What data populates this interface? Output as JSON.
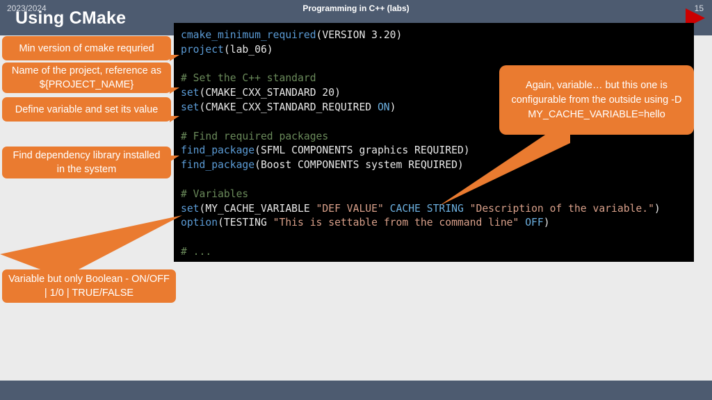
{
  "slide": {
    "title": "Using CMake",
    "play_icon": "play-triangle-icon",
    "accent_color": "#ea7b30",
    "header_color": "#4d5b70",
    "code_bg_color": "#000000"
  },
  "code": {
    "language": "cmake",
    "lines": [
      [
        {
          "t": "cmake_minimum_required",
          "c": "fn"
        },
        {
          "t": "(VERSION 3.20)",
          "c": "plain"
        }
      ],
      [
        {
          "t": "project",
          "c": "fn"
        },
        {
          "t": "(lab_06)",
          "c": "plain"
        }
      ],
      [],
      [
        {
          "t": "# Set the C++ standard",
          "c": "comment"
        }
      ],
      [
        {
          "t": "set",
          "c": "fn"
        },
        {
          "t": "(CMAKE_CXX_STANDARD 20)",
          "c": "plain"
        }
      ],
      [
        {
          "t": "set",
          "c": "fn"
        },
        {
          "t": "(CMAKE_CXX_STANDARD_REQUIRED ",
          "c": "plain"
        },
        {
          "t": "ON",
          "c": "kw"
        },
        {
          "t": ")",
          "c": "plain"
        }
      ],
      [],
      [
        {
          "t": "# Find required packages",
          "c": "comment"
        }
      ],
      [
        {
          "t": "find_package",
          "c": "fn"
        },
        {
          "t": "(SFML COMPONENTS graphics REQUIRED)",
          "c": "plain"
        }
      ],
      [
        {
          "t": "find_package",
          "c": "fn"
        },
        {
          "t": "(Boost COMPONENTS system REQUIRED)",
          "c": "plain"
        }
      ],
      [],
      [
        {
          "t": "# Variables",
          "c": "comment"
        }
      ],
      [
        {
          "t": "set",
          "c": "fn"
        },
        {
          "t": "(MY_CACHE_VARIABLE ",
          "c": "plain"
        },
        {
          "t": "\"DEF VALUE\"",
          "c": "str"
        },
        {
          "t": " ",
          "c": "plain"
        },
        {
          "t": "CACHE STRING",
          "c": "kw"
        },
        {
          "t": " ",
          "c": "plain"
        },
        {
          "t": "\"Description of the variable.\"",
          "c": "str"
        },
        {
          "t": ")",
          "c": "plain"
        }
      ],
      [
        {
          "t": "option",
          "c": "fn"
        },
        {
          "t": "(TESTING ",
          "c": "plain"
        },
        {
          "t": "\"This is settable from the command line\"",
          "c": "str"
        },
        {
          "t": " ",
          "c": "plain"
        },
        {
          "t": "OFF",
          "c": "kw"
        },
        {
          "t": ")",
          "c": "plain"
        }
      ],
      [],
      [
        {
          "t": "# ...",
          "c": "comment"
        }
      ]
    ]
  },
  "callouts": {
    "min_version": "Min version of cmake requried",
    "project_name": "Name of the project, reference as ${PROJECT_NAME}",
    "define_variable": "Define variable and set its value",
    "find_dependency": "Find dependency library installed in the system",
    "boolean_option": "Variable but only Boolean - ON/OFF | 1/0 | TRUE/FALSE",
    "cache_variable": "Again, variable… but this one is configurable from the outside using -D MY_CACHE_VARIABLE=hello"
  },
  "footer": {
    "year": "2023/2024",
    "course": "Programming in C++ (labs)",
    "page": "15"
  }
}
